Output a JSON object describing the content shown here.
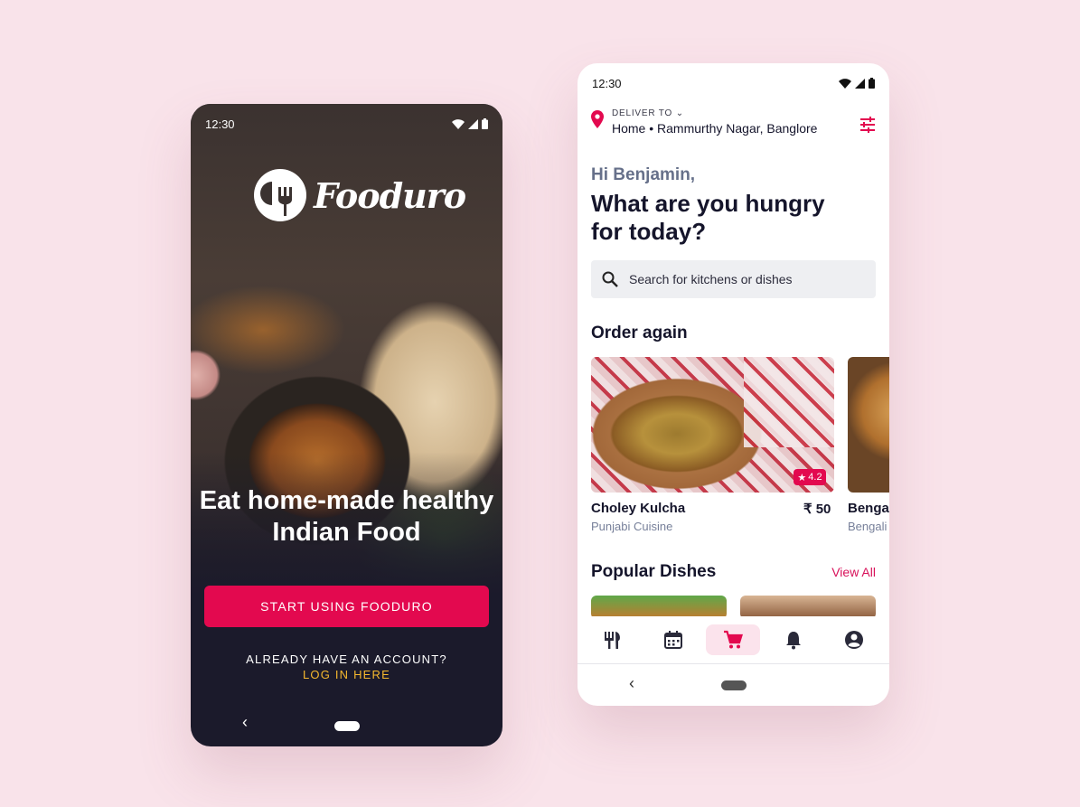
{
  "colors": {
    "background": "#f9e3ea",
    "brand": "#e3094f",
    "accent": "#f5b82e",
    "dark": "#1b1a2b"
  },
  "onboarding": {
    "status_time": "12:30",
    "logo_text": "Fooduro",
    "headline": "Eat home-made healthy Indian Food",
    "cta_label": "START USING FOODURO",
    "account_prompt": "ALREADY HAVE AN ACCOUNT?",
    "login_link": "LOG IN HERE",
    "nav_back": "‹"
  },
  "home": {
    "status_time": "12:30",
    "deliver_label": "DELIVER TO",
    "address": "Home • Rammurthy Nagar, Banglore",
    "greeting": "Hi Benjamin,",
    "question": "What are you hungry for today?",
    "search_placeholder": "Search for kitchens or dishes",
    "order_again_title": "Order again",
    "order_again": [
      {
        "name": "Choley Kulcha",
        "cuisine": "Punjabi Cuisine",
        "price": "₹ 50",
        "rating": "4.2"
      },
      {
        "name": "Benga",
        "cuisine": "Bengali"
      }
    ],
    "popular_title": "Popular Dishes",
    "view_all": "View All",
    "tabs": [
      {
        "icon": "fork-knife-icon"
      },
      {
        "icon": "calendar-icon"
      },
      {
        "icon": "cart-icon",
        "active": true
      },
      {
        "icon": "bell-icon"
      },
      {
        "icon": "profile-icon"
      }
    ],
    "nav_back": "‹"
  }
}
